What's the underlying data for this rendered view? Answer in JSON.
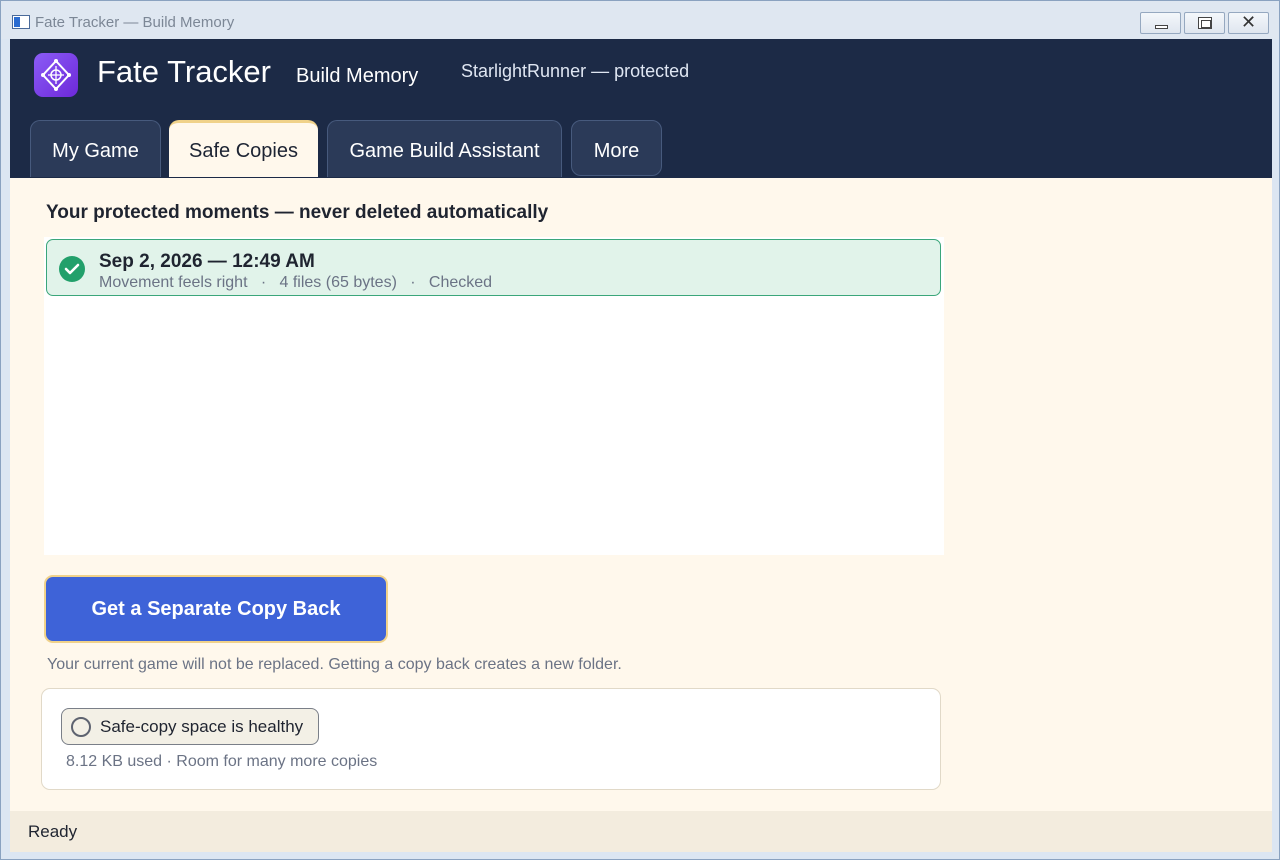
{
  "window": {
    "title": "Fate Tracker — Build Memory"
  },
  "header": {
    "app_title": "Fate Tracker",
    "subtitle": "Build Memory",
    "project_status": "StarlightRunner — protected"
  },
  "tabs": [
    {
      "label": "My Game",
      "active": false
    },
    {
      "label": "Safe Copies",
      "active": true
    },
    {
      "label": "Game Build Assistant",
      "active": false
    },
    {
      "label": "More",
      "active": false
    }
  ],
  "main": {
    "heading": "Your protected moments — never deleted automatically",
    "snapshots": [
      {
        "timestamp": "Sep 2, 2026 — 12:49 AM",
        "meta": "Movement feels right   ·   4 files (65 bytes)   ·   Checked",
        "status_icon": "check-circle-icon",
        "selected": true
      }
    ],
    "restore_button": "Get a Separate Copy Back",
    "restore_note": "Your current game will not be replaced. Getting a copy back creates a new folder.",
    "storage": {
      "status_label": "Safe-copy space is healthy",
      "usage_text": "8.12 KB used · Room for many more copies"
    }
  },
  "status_bar": {
    "text": "Ready"
  },
  "colors": {
    "header_bg": "#1c2a46",
    "content_bg": "#fff8ec",
    "accent_button": "#3e63d8",
    "success": "#22a06b",
    "selected_row_bg": "#e1f3ea",
    "tab_active_border": "#f0d28a"
  }
}
